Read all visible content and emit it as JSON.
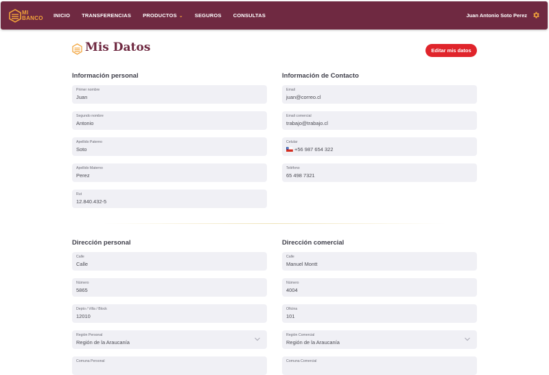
{
  "brand": {
    "line1": "MI",
    "line2": "BANCO"
  },
  "nav": {
    "items": [
      {
        "label": "INICIO"
      },
      {
        "label": "TRANSFERENCIAS"
      },
      {
        "label": "PRODUCTOS"
      },
      {
        "label": "SEGUROS"
      },
      {
        "label": "CONSULTAS"
      }
    ],
    "products_has_dropdown": true
  },
  "user": {
    "name": "Juan Antonio Soto Perez"
  },
  "page": {
    "title": "Mis Datos",
    "edit_button": "Editar mis datos"
  },
  "personal_info": {
    "title": "Información personal",
    "fields": [
      {
        "label": "Primer nombre",
        "value": "Juan"
      },
      {
        "label": "Segundo nombre",
        "value": "Antonio"
      },
      {
        "label": "Apellido Paterno",
        "value": "Soto"
      },
      {
        "label": "Apellido Materno",
        "value": "Perez"
      },
      {
        "label": "Rut",
        "value": "12.840.432-5"
      }
    ]
  },
  "contact_info": {
    "title": "Información de Contacto",
    "fields": [
      {
        "label": "Email",
        "value": "juan@correo.cl"
      },
      {
        "label": "Email comercial",
        "value": "trabajo@trabajo.cl"
      },
      {
        "label": "Celular",
        "value": "+56 987 654 322"
      },
      {
        "label": "Teléfono",
        "value": "65 498 7321"
      }
    ]
  },
  "personal_address": {
    "title": "Dirección personal",
    "fields": [
      {
        "label": "Calle",
        "value": "Calle"
      },
      {
        "label": "Número",
        "value": "5865"
      },
      {
        "label": "Depto / Villa / Block",
        "value": "12010"
      },
      {
        "label": "Región Personal",
        "value": "Región de la Araucanía"
      },
      {
        "label": "Comuna Personal",
        "value": ""
      }
    ]
  },
  "commercial_address": {
    "title": "Dirección comercial",
    "fields": [
      {
        "label": "Calle",
        "value": "Manuel Montt"
      },
      {
        "label": "Número",
        "value": "4004"
      },
      {
        "label": "Oficina",
        "value": "101"
      },
      {
        "label": "Región Comercial",
        "value": "Región de la Araucanía"
      },
      {
        "label": "Comuna Comercial",
        "value": ""
      }
    ]
  },
  "colors": {
    "brand": "#6f2941",
    "accent": "#f2a33a",
    "button": "#e0242b",
    "field_bg": "#f0f0f5"
  }
}
